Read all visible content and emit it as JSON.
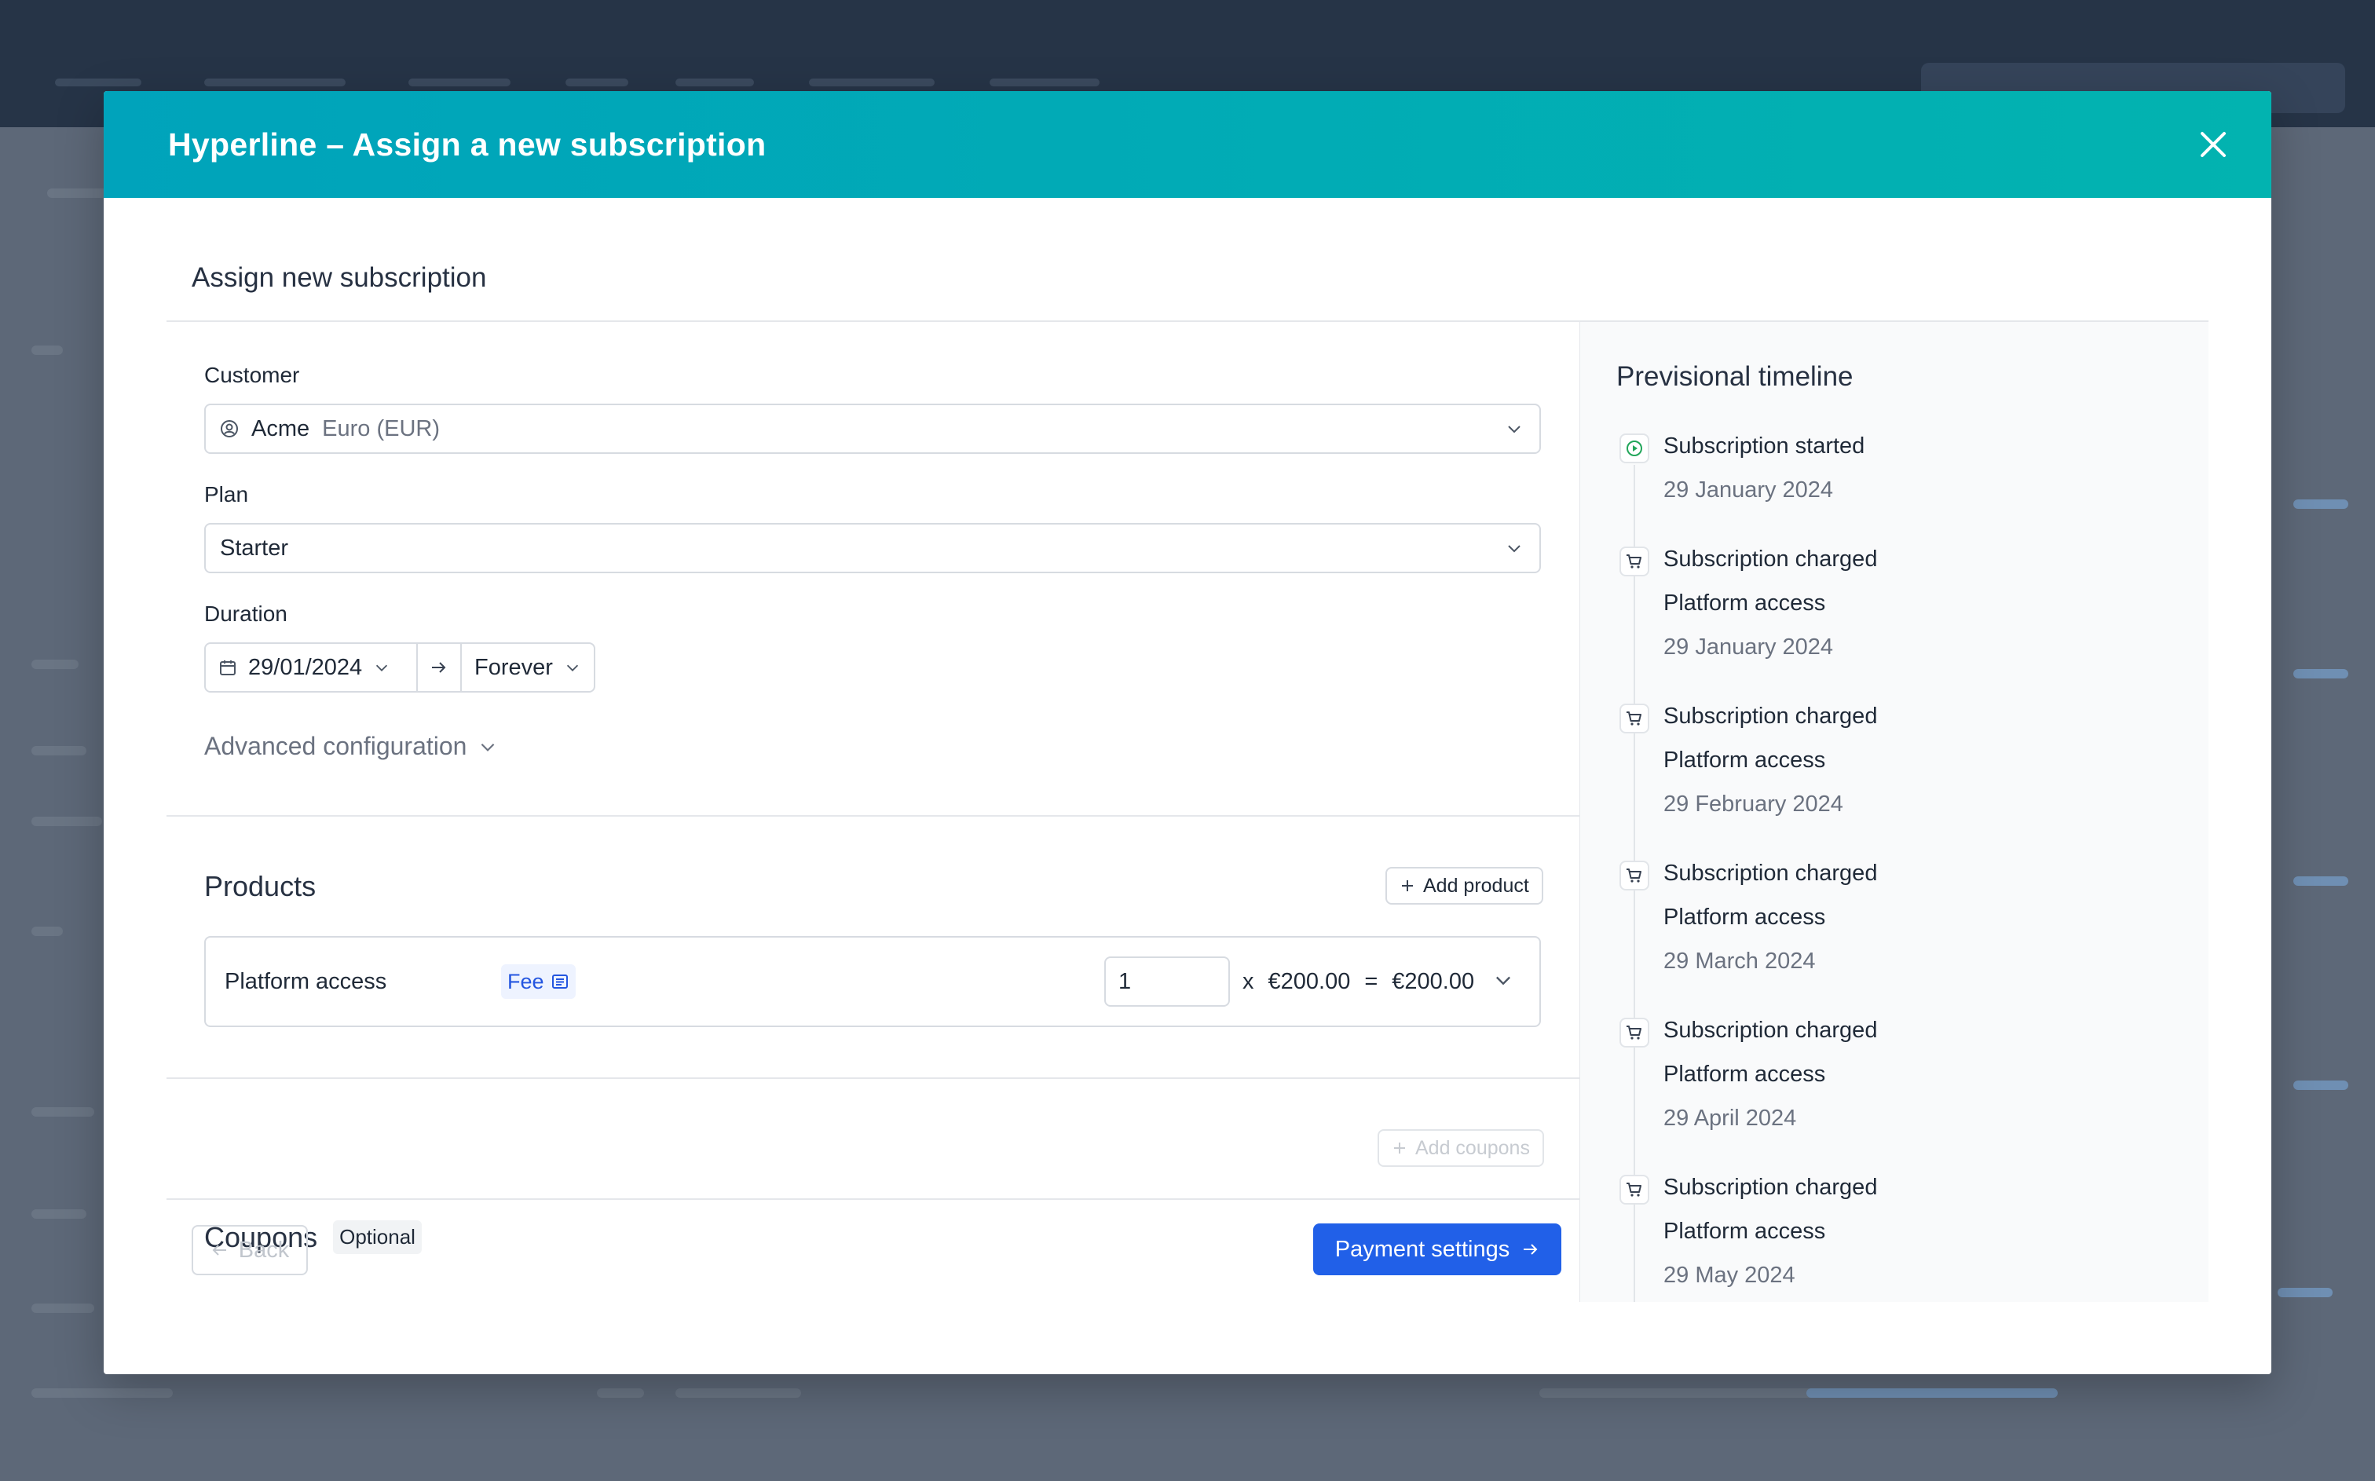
{
  "modal": {
    "title": "Hyperline – Assign a new subscription",
    "heading": "Assign new subscription"
  },
  "form": {
    "customer_label": "Customer",
    "customer_name": "Acme",
    "customer_currency": "Euro (EUR)",
    "plan_label": "Plan",
    "plan_value": "Starter",
    "duration_label": "Duration",
    "start_date": "29/01/2024",
    "end_value": "Forever",
    "advanced_config": "Advanced configuration"
  },
  "products": {
    "title": "Products",
    "add_label": "Add product",
    "items": [
      {
        "name": "Platform access",
        "badge": "Fee",
        "quantity": "1",
        "times": "x",
        "unit_price": "€200.00",
        "equals": "=",
        "total": "€200.00"
      }
    ]
  },
  "coupons": {
    "title": "Coupons",
    "optional": "Optional",
    "add_label": "Add coupons"
  },
  "footer": {
    "back_label": "Back",
    "next_label": "Payment settings"
  },
  "timeline": {
    "title": "Previsional timeline",
    "events": [
      {
        "icon": "play-circle-icon",
        "title": "Subscription started",
        "detail": "",
        "date": "29 January 2024"
      },
      {
        "icon": "cart-icon",
        "title": "Subscription charged",
        "detail": "Platform access",
        "date": "29 January 2024"
      },
      {
        "icon": "cart-icon",
        "title": "Subscription charged",
        "detail": "Platform access",
        "date": "29 February 2024"
      },
      {
        "icon": "cart-icon",
        "title": "Subscription charged",
        "detail": "Platform access",
        "date": "29 March 2024"
      },
      {
        "icon": "cart-icon",
        "title": "Subscription charged",
        "detail": "Platform access",
        "date": "29 April 2024"
      },
      {
        "icon": "cart-icon",
        "title": "Subscription charged",
        "detail": "Platform access",
        "date": "29 May 2024"
      }
    ]
  },
  "colors": {
    "header_gradient_start": "#00a3bb",
    "header_gradient_end": "#02b3b0",
    "primary": "#2160e8",
    "badge_blue": "#2456e0",
    "started_green": "#22a65a"
  }
}
